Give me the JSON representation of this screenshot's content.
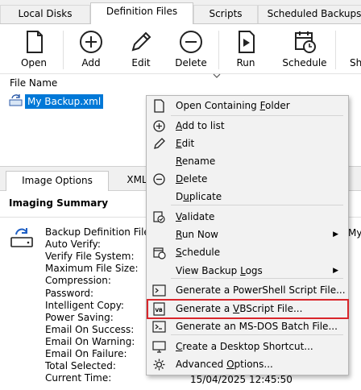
{
  "tabs": [
    "Local Disks",
    "Definition Files",
    "Scripts",
    "Scheduled Backups"
  ],
  "toolbar": {
    "open": "Open",
    "add": "Add",
    "edit": "Edit",
    "delete": "Delete",
    "run": "Run",
    "schedule": "Schedule",
    "sh": "Sh"
  },
  "filelist": {
    "column_header": "File Name",
    "file": "My Backup.xml"
  },
  "lower": {
    "tabs": [
      "Image Options",
      "XML"
    ],
    "summary_title": "Imaging Summary",
    "labels": [
      "Backup Definition File:",
      "Auto Verify:",
      "Verify File System:",
      "Maximum File Size:",
      "Compression:",
      "Password:",
      "Intelligent Copy:",
      "Power Saving:",
      "Email On Success:",
      "Email On Warning:",
      "Email On Failure:",
      "Total Selected:",
      "Current Time:"
    ],
    "partial_value": "My",
    "current_time": "15/04/2025 12:45:50"
  },
  "context_menu": {
    "items": [
      {
        "pre": "Open Containing ",
        "u": "F",
        "post": "older",
        "icon": "document-icon"
      },
      {
        "pre": "",
        "u": "A",
        "post": "dd to list",
        "icon": "plus-circle-icon"
      },
      {
        "pre": "",
        "u": "E",
        "post": "dit",
        "icon": "pencil-icon"
      },
      {
        "pre": "",
        "u": "R",
        "post": "ename",
        "icon": ""
      },
      {
        "pre": "",
        "u": "D",
        "post": "elete",
        "icon": "minus-circle-icon"
      },
      {
        "pre": "D",
        "u": "u",
        "post": "plicate",
        "icon": ""
      },
      {
        "pre": "",
        "u": "V",
        "post": "alidate",
        "icon": "validate-icon"
      },
      {
        "pre": "",
        "u": "R",
        "post": "un Now",
        "icon": ""
      },
      {
        "pre": "",
        "u": "S",
        "post": "chedule",
        "icon": "schedule-icon"
      },
      {
        "pre": "View Backup ",
        "u": "L",
        "post": "ogs",
        "icon": ""
      },
      {
        "pre": "Generate a PowerShell Script File...",
        "u": "",
        "post": "",
        "icon": "powershell-icon"
      },
      {
        "pre": "Generate a ",
        "u": "V",
        "post": "BScript File...",
        "icon": "vbscript-icon"
      },
      {
        "pre": "Generate an MS-DOS Batch File...",
        "u": "",
        "post": "",
        "icon": "batch-icon"
      },
      {
        "pre": "",
        "u": "C",
        "post": "reate a Desktop Shortcut...",
        "icon": "shortcut-icon"
      },
      {
        "pre": "Advanced ",
        "u": "O",
        "post": "ptions...",
        "icon": "gear-icon"
      }
    ]
  },
  "colors": {
    "selection": "#0078d7",
    "highlight_border": "#d9262b",
    "menu_background": "#f2f2f2"
  }
}
